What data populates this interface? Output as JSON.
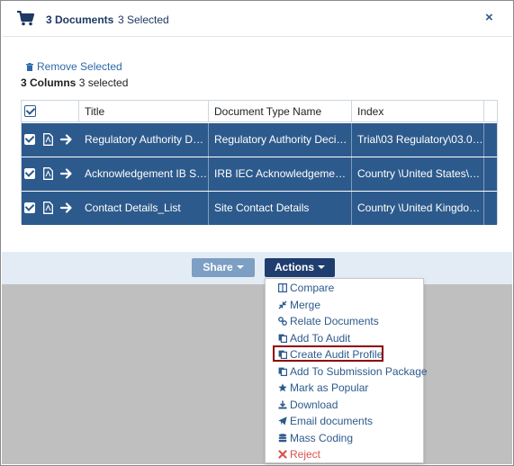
{
  "header": {
    "documents_label": "3 Documents",
    "selected_label": "3 Selected",
    "close_glyph": "×"
  },
  "toolbar": {
    "remove_selected": "Remove Selected",
    "columns_count": "3 Columns",
    "columns_selected": "3 selected"
  },
  "grid": {
    "columns": [
      "Title",
      "Document Type Name",
      "Index"
    ],
    "rows": [
      {
        "title": "Regulatory Authority Deci...",
        "type": "Regulatory Authority Decisi...",
        "index": "Trial\\03 Regulatory\\03.01 ..."
      },
      {
        "title": "Acknowledgement IB Sign...",
        "type": "IRB IEC Acknowledgement ...",
        "index": "Country \\United States\\04..."
      },
      {
        "title": "Contact Details_List",
        "type": "Site Contact Details",
        "index": "Country \\United Kingdom..."
      }
    ]
  },
  "buttons": {
    "share": "Share",
    "actions": "Actions"
  },
  "menu": {
    "items": [
      {
        "label": "Compare",
        "icon": "columns-icon"
      },
      {
        "label": "Merge",
        "icon": "compress-icon"
      },
      {
        "label": "Relate Documents",
        "icon": "link-icon"
      },
      {
        "label": "Add To Audit",
        "icon": "copy-icon"
      },
      {
        "label": "Create Audit Profile",
        "icon": "copy-icon"
      },
      {
        "label": "Add To Submission Package",
        "icon": "copy-icon"
      },
      {
        "label": "Mark as Popular",
        "icon": "star-icon"
      },
      {
        "label": "Download",
        "icon": "download-icon"
      },
      {
        "label": "Email documents",
        "icon": "send-icon"
      },
      {
        "label": "Mass Coding",
        "icon": "database-icon"
      },
      {
        "label": "Reject",
        "icon": "times-icon"
      }
    ]
  },
  "colors": {
    "accent": "#2d5a8c",
    "selected_row": "#2d5a8c",
    "reject": "#d9534f",
    "highlight_border": "#8b0000"
  }
}
